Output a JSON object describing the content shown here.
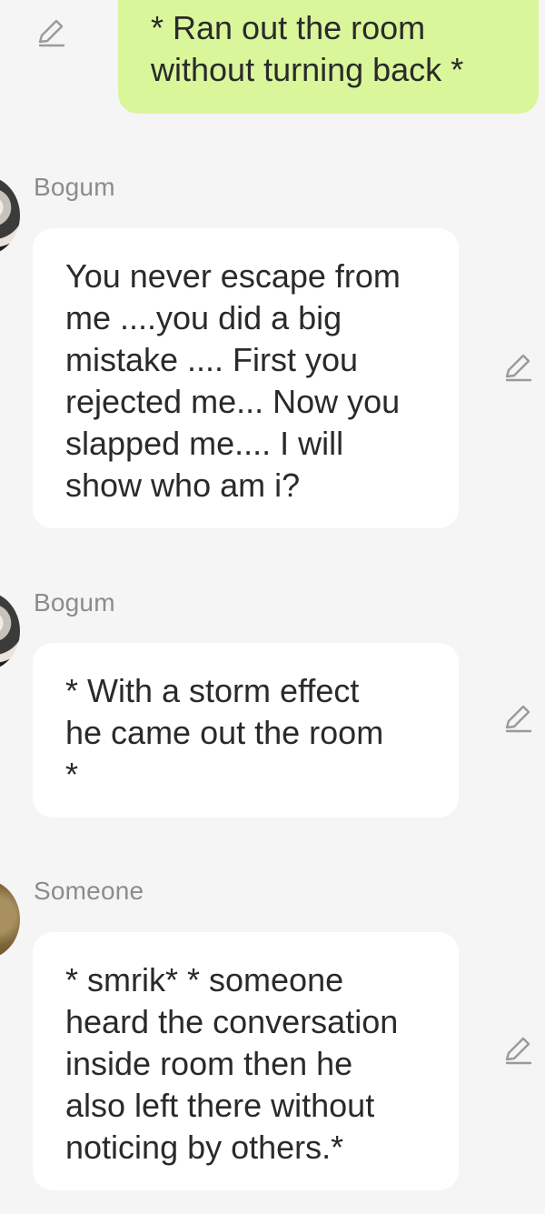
{
  "messages": [
    {
      "direction": "outgoing",
      "text": "* Ran out the room\nwithout turning back *"
    },
    {
      "direction": "incoming",
      "sender": "Bogum",
      "text": "You never escape from\nme ....you did a big\nmistake .... First you\nrejected me... Now you\nslapped me.... I will\nshow who am i?"
    },
    {
      "direction": "incoming",
      "sender": "Bogum",
      "text": "* With a storm effect\nhe came out the room\n*"
    },
    {
      "direction": "incoming",
      "sender": "Someone",
      "text": "* smrik* * someone\nheard the conversation\ninside room then he\nalso left there without\nnoticing by others.*"
    }
  ],
  "icons": {
    "edit": "edit-pencil-icon",
    "avatar_bogum": "bogum-avatar",
    "avatar_someone": "someone-avatar"
  },
  "colors": {
    "outgoing_bubble": "#daf69a",
    "incoming_bubble": "#ffffff",
    "background": "#f5f5f5",
    "sender_name": "#8c8c8c",
    "message_text": "#2a2a2a",
    "icon": "#9a9a9a"
  }
}
